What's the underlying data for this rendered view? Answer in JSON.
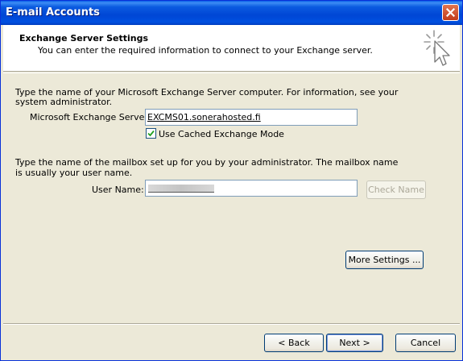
{
  "window": {
    "title": "E-mail Accounts"
  },
  "header": {
    "title": "Exchange Server Settings",
    "subtitle": "You can enter the required information to connect to your Exchange server.",
    "icon": "magic-wand-cursor-icon"
  },
  "server_section": {
    "instructions_line1": "Type the name of your Microsoft Exchange Server computer. For information, see your",
    "instructions_line2": "system administrator.",
    "server_label": "Microsoft Exchange Server:",
    "server_value": "EXCMS01.sonerahosted.fi",
    "cached_mode_label": "Use Cached Exchange Mode",
    "cached_mode_checked": true
  },
  "mailbox_section": {
    "instructions_line1": "Type the name of the mailbox set up for you by your administrator. The mailbox name",
    "instructions_line2": "is usually your user name.",
    "username_label": "User Name:",
    "username_value_redacted": true,
    "check_name_label": "Check Name",
    "check_name_enabled": false
  },
  "more_settings_label": "More Settings ...",
  "footer": {
    "back_label": "< Back",
    "next_label": "Next >",
    "cancel_label": "Cancel"
  },
  "colors": {
    "titlebar": "#0054e3",
    "dialog_bg": "#ece9d8",
    "close_button": "#d4532f"
  }
}
